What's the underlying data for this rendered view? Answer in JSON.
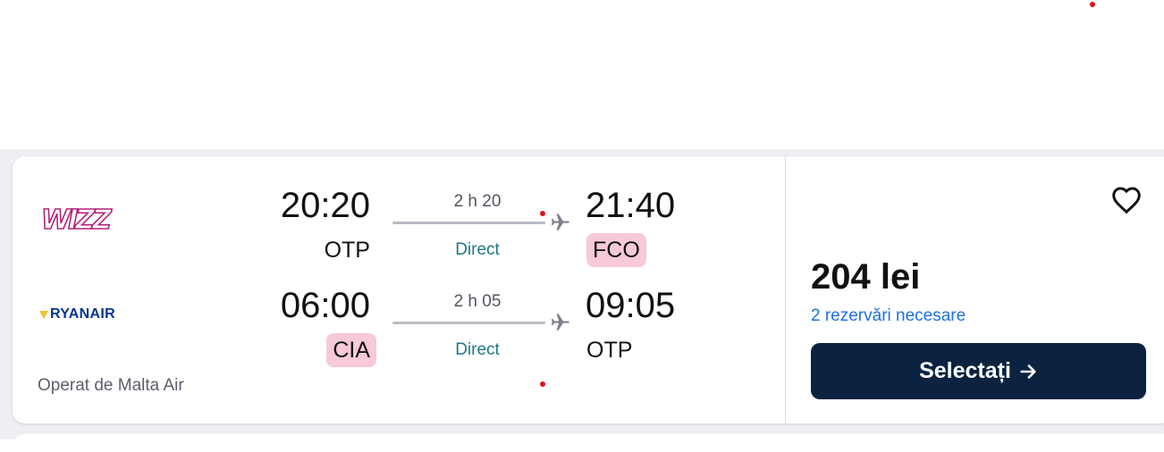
{
  "result": {
    "legs": [
      {
        "airline_logo": "WIZZ",
        "airline_icon": "wizz-logo-icon",
        "departure_time": "20:20",
        "departure_airport": "OTP",
        "duration": "2 h 20",
        "stops": "Direct",
        "arrival_time": "21:40",
        "arrival_airport": "FCO"
      },
      {
        "airline_logo": "RYANAIR",
        "airline_icon": "ryanair-logo-icon",
        "departure_time": "06:00",
        "departure_airport": "CIA",
        "duration": "2 h 05",
        "stops": "Direct",
        "arrival_time": "09:05",
        "arrival_airport": "OTP"
      }
    ],
    "operated_by": "Operat de Malta Air",
    "price": "204 lei",
    "bookings_required": "2 rezervări necesare",
    "select_label": "Selectați",
    "select_icon": "arrow-right-icon",
    "favorite_icon": "heart-icon"
  },
  "colors": {
    "airport_highlight": "#f7c9d9",
    "stops_text": "#1d7a85",
    "link": "#1f6fe0",
    "primary_button": "#0b2340",
    "marker_dot": "#e0121b"
  }
}
